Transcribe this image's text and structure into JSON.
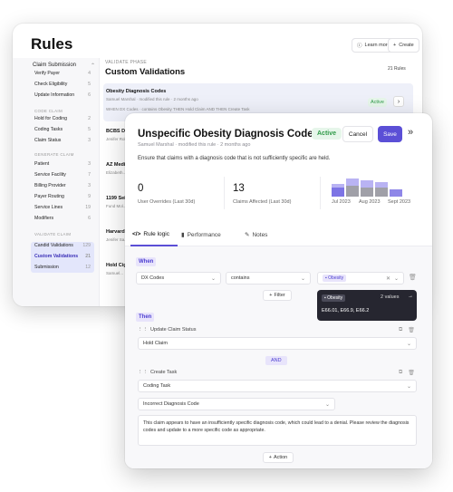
{
  "bg": {
    "title": "Rules",
    "learn_more": "Learn more",
    "create": "Create",
    "sidebar": {
      "header": "Claim Submission",
      "items_top": [
        {
          "label": "Verify Payer",
          "count": "4"
        },
        {
          "label": "Check Eligibility",
          "count": "5"
        },
        {
          "label": "Update Information",
          "count": "6"
        }
      ],
      "sec_code": "CODE CLAIM",
      "items_code": [
        {
          "label": "Hold for Coding",
          "count": "2"
        },
        {
          "label": "Coding Tasks",
          "count": "5"
        },
        {
          "label": "Claim Status",
          "count": "3"
        }
      ],
      "sec_generate": "GENERATE CLAIM",
      "items_generate": [
        {
          "label": "Patient",
          "count": "3"
        },
        {
          "label": "Service Facility",
          "count": "7"
        },
        {
          "label": "Billing Provider",
          "count": "3"
        },
        {
          "label": "Payer Routing",
          "count": "9"
        },
        {
          "label": "Service Lines",
          "count": "19"
        },
        {
          "label": "Modifiers",
          "count": "6"
        }
      ],
      "sec_validate": "VALIDATE CLAIM",
      "items_validate": [
        {
          "label": "Candid Validations",
          "count": "129"
        },
        {
          "label": "Custom Validations",
          "count": "21"
        },
        {
          "label": "Submission",
          "count": "12"
        }
      ]
    },
    "main": {
      "phase": "VALIDATE PHASE",
      "heading": "Custom Validations",
      "count": "21 Rules",
      "cards": [
        {
          "name": "Obesity Diagnosis Codes",
          "sub": "Samuel Marshal · modified this rule · 2 months ago",
          "when": "WHEN  DX Codes · contains  Obesity  THEN  Hold Claim  AND THEN  Create Task",
          "status": "Active"
        },
        {
          "name": "BCBS Diag...",
          "sub": "Jenifer Rob..."
        },
        {
          "name": "AZ Medic...",
          "sub": "Elizabeth..."
        },
        {
          "name": "1199 Seiu...",
          "sub": "Fund Mol..."
        },
        {
          "name": "Harvard P...",
          "sub": "Jenifer Sa..."
        },
        {
          "name": "Hold Cign...",
          "sub": "Samuel..."
        }
      ]
    }
  },
  "modal": {
    "title": "Unspecific Obesity Diagnosis Codes",
    "status": "Active",
    "cancel": "Cancel",
    "save": "Save",
    "byline": "Samuel Marshal · modified this rule · 2 months ago",
    "description": "Ensure that claims with a diagnosis code that is not sufficiently specific are held.",
    "stats": [
      {
        "value": "0",
        "label": "User Overrides (Last 30d)"
      },
      {
        "value": "13",
        "label": "Claims Affected (Last 30d)"
      }
    ],
    "mini_chart": {
      "months": [
        "Jul 2023",
        "Aug 2023",
        "Sept 2023"
      ],
      "colors": {
        "light": "#b9b3f3",
        "accent": "#6a5fe0",
        "gray": "#a0a0a8"
      }
    },
    "tabs": [
      {
        "label": "Rule logic"
      },
      {
        "label": "Performance"
      },
      {
        "label": "Notes"
      }
    ],
    "when": "When",
    "cond": {
      "field": "DX Codes",
      "op": "contains",
      "chip": "Obesity"
    },
    "add_filter": "Filter",
    "tooltip": {
      "chip": "Obesity",
      "count": "2 values",
      "values": "E66.01, E66.9, E66.2"
    },
    "then": "Then",
    "action1": {
      "label": "Update Claim Status",
      "value": "Hold Claim"
    },
    "and": "AND",
    "action2": {
      "label": "Create Task",
      "type": "Coding Task",
      "reason": "Incorrect Diagnosis Code",
      "message": "This claim appears to have an insufficiently specific diagnosis code, which could lead to a denial. Please review the diagnosis codes and update to a more specific code as appropriate."
    },
    "add_action": "Action"
  }
}
